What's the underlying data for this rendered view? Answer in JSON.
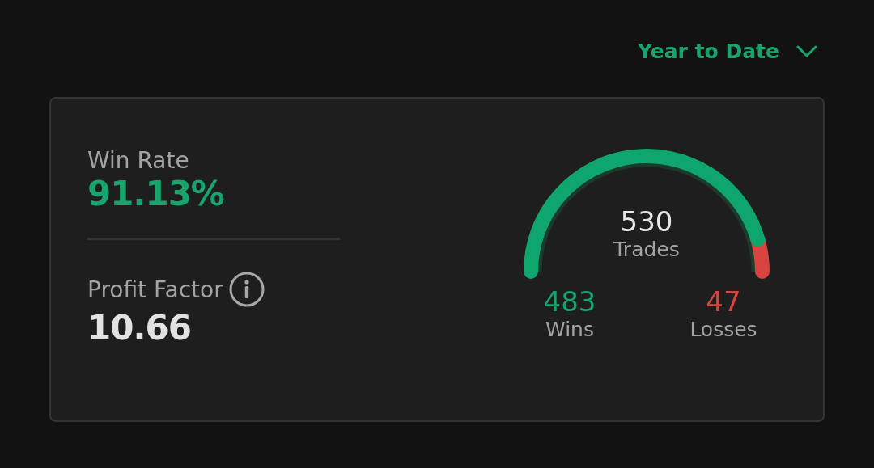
{
  "period_selector": {
    "label": "Year to Date"
  },
  "win_rate": {
    "label": "Win Rate",
    "value": "91.13%"
  },
  "profit_factor": {
    "label": "Profit Factor",
    "value": "10.66"
  },
  "gauge": {
    "total": "530",
    "total_label": "Trades",
    "wins": {
      "value": "483",
      "label": "Wins"
    },
    "losses": {
      "value": "47",
      "label": "Losses"
    }
  }
}
